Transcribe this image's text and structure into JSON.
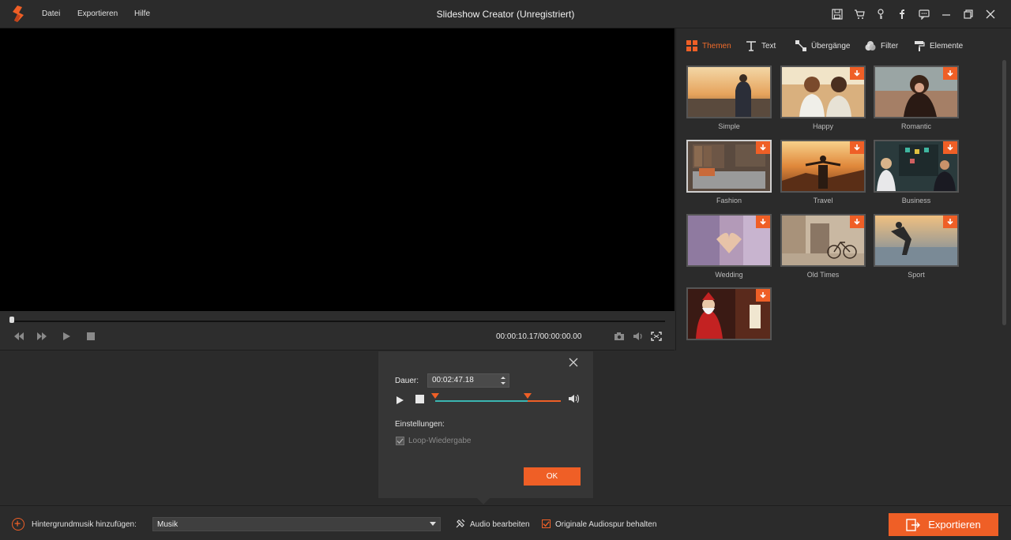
{
  "app": {
    "title": "Slideshow Creator (Unregistriert)",
    "accent": "#ef5f26",
    "logo": "slideshow-logo"
  },
  "menu": [
    {
      "label": "Datei"
    },
    {
      "label": "Exportieren"
    },
    {
      "label": "Hilfe"
    }
  ],
  "titlebar_icons": [
    "save-icon",
    "cart-icon",
    "key-icon",
    "facebook-icon",
    "feedback-icon",
    "minimize-icon",
    "restore-icon",
    "close-icon"
  ],
  "player": {
    "timecode": "00:00:10.17/00:00:00.00",
    "progress": 0.0,
    "buttons": [
      "rewind-icon",
      "fast-forward-icon",
      "play-icon",
      "stop-icon",
      "snapshot-icon",
      "volume-icon",
      "fullscreen-icon"
    ]
  },
  "tabs": [
    {
      "label": "Themen",
      "icon": "grid-icon",
      "active": true
    },
    {
      "label": "Text",
      "icon": "text-icon",
      "active": false
    },
    {
      "label": "Übergänge",
      "icon": "transition-icon",
      "active": false
    },
    {
      "label": "Filter",
      "icon": "filter-icon",
      "active": false
    },
    {
      "label": "Elemente",
      "icon": "paint-roller-icon",
      "active": false
    }
  ],
  "themes": [
    {
      "label": "Simple",
      "downloadable": false,
      "selected": false
    },
    {
      "label": "Happy",
      "downloadable": true,
      "selected": false
    },
    {
      "label": "Romantic",
      "downloadable": true,
      "selected": false
    },
    {
      "label": "Fashion",
      "downloadable": true,
      "selected": true
    },
    {
      "label": "Travel",
      "downloadable": true,
      "selected": false
    },
    {
      "label": "Business",
      "downloadable": true,
      "selected": false
    },
    {
      "label": "Wedding",
      "downloadable": true,
      "selected": false
    },
    {
      "label": "Old Times",
      "downloadable": true,
      "selected": false
    },
    {
      "label": "Sport",
      "downloadable": true,
      "selected": false
    },
    {
      "label": "",
      "downloadable": true,
      "selected": false
    }
  ],
  "dialog": {
    "duration_label": "Dauer:",
    "duration_value": "00:02:47.18",
    "settings_label": "Einstellungen:",
    "loop_label": "Loop-Wiedergabe",
    "loop_checked": true,
    "ok_label": "OK"
  },
  "bottom": {
    "add_music_label": "Hintergrundmusik hinzufügen:",
    "music_select_value": "Musik",
    "audio_edit_label": "Audio bearbeiten",
    "keep_original_label": "Originale Audiospur behalten",
    "keep_original_checked": true,
    "export_label": "Exportieren"
  }
}
